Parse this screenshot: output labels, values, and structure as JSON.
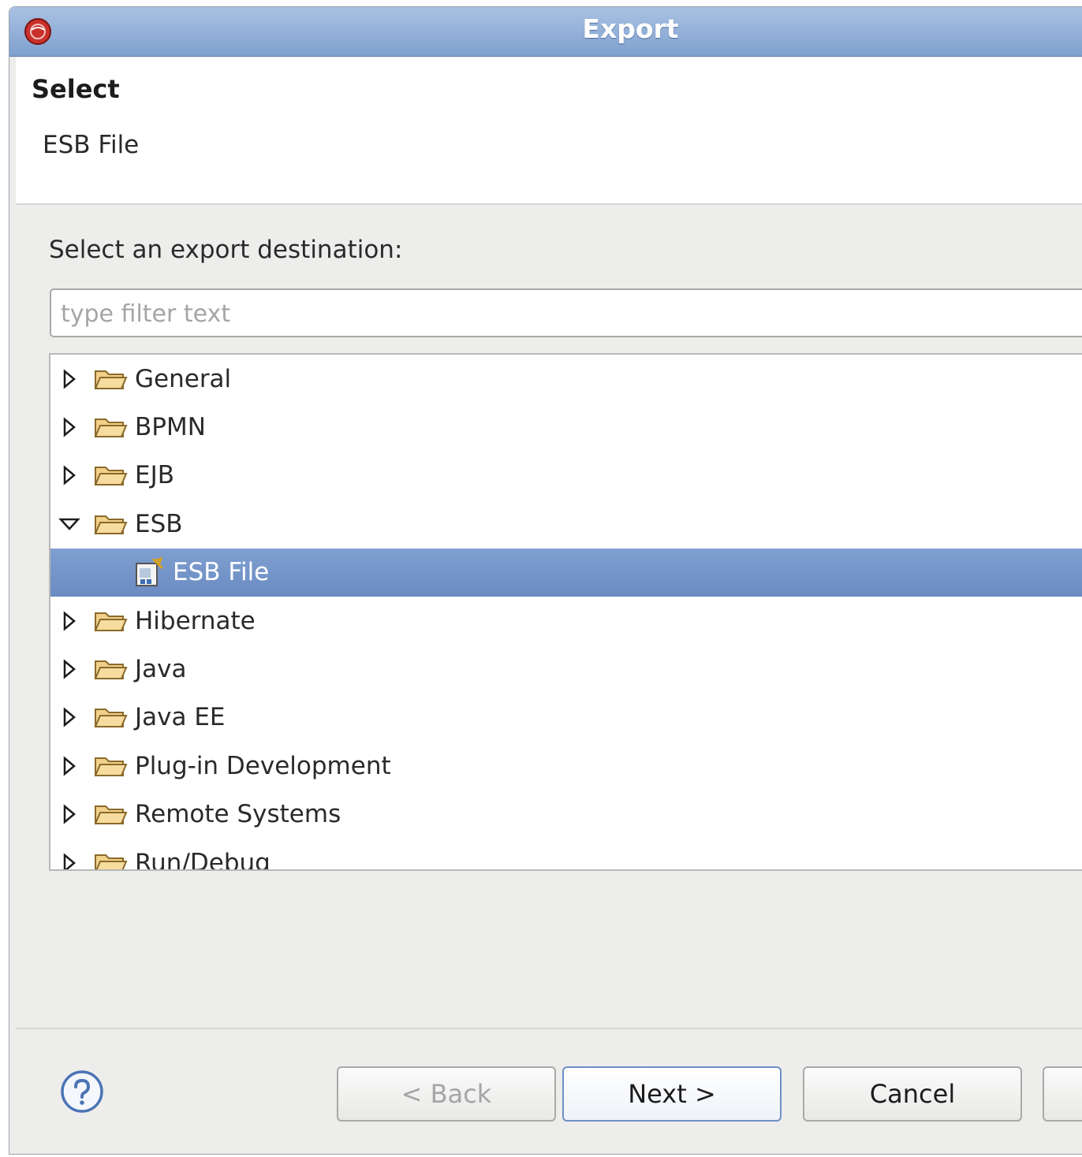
{
  "window": {
    "title": "Export",
    "app_icon": "eclipse-redhat-icon"
  },
  "header": {
    "title": "Select",
    "description": "ESB File"
  },
  "prompt": "Select an export destination:",
  "filter": {
    "placeholder": "type filter text",
    "value": ""
  },
  "tree": {
    "items": [
      {
        "label": "General",
        "expanded": false,
        "icon": "folder-icon"
      },
      {
        "label": "BPMN",
        "expanded": false,
        "icon": "folder-icon"
      },
      {
        "label": "EJB",
        "expanded": false,
        "icon": "folder-icon"
      },
      {
        "label": "ESB",
        "expanded": true,
        "icon": "folder-icon"
      },
      {
        "label": "ESB File",
        "selected": true,
        "icon": "esb-file-wizard-icon"
      },
      {
        "label": "Hibernate",
        "expanded": false,
        "icon": "folder-icon"
      },
      {
        "label": "Java",
        "expanded": false,
        "icon": "folder-icon"
      },
      {
        "label": "Java EE",
        "expanded": false,
        "icon": "folder-icon"
      },
      {
        "label": "Plug-in Development",
        "expanded": false,
        "icon": "folder-icon"
      },
      {
        "label": "Remote Systems",
        "expanded": false,
        "icon": "folder-icon"
      },
      {
        "label": "Run/Debug",
        "expanded": false,
        "icon": "folder-icon"
      }
    ]
  },
  "buttons": {
    "back": "< Back",
    "next": "Next >",
    "cancel": "Cancel"
  },
  "colors": {
    "titlebar": "#8fb0dc",
    "selection": "#7494c9",
    "folder": "#e8b860"
  }
}
